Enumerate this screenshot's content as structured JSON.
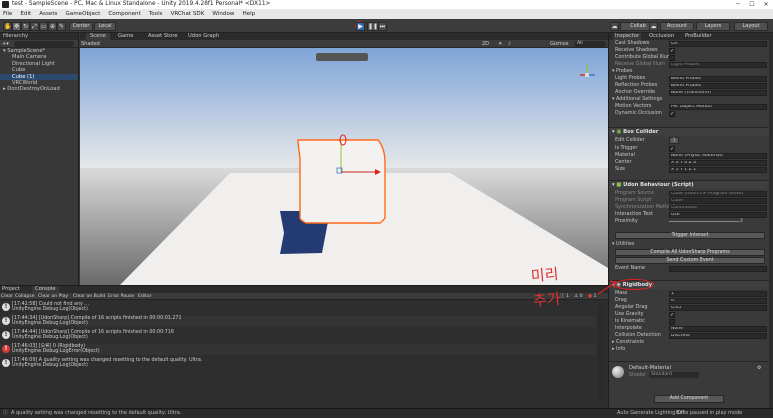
{
  "window": {
    "title": "test - SampleScene - PC, Mac & Linux Standalone - Unity 2019.4.28f1 Personal* <DX11>"
  },
  "menu": [
    "File",
    "Edit",
    "Assets",
    "GameObject",
    "Component",
    "Tools",
    "VRChat SDK",
    "Window",
    "Help"
  ],
  "toolbar": {
    "center": "Center",
    "local": "Local",
    "collab": "Collab",
    "account": "Account",
    "layers": "Layers",
    "layout": "Layout"
  },
  "hierarchy": {
    "tab": "Hierarchy",
    "root": "SampleScene*",
    "items": [
      "Main Camera",
      "Directional Light",
      "Cube",
      "Cube (1)",
      "VRCWorld"
    ],
    "dont_destroy": "DontDestroyOnLoad"
  },
  "scene": {
    "tabs": [
      "Scene",
      "Game",
      "Asset Store",
      "Udon Graph"
    ],
    "shading": "Shaded",
    "twod": "2D",
    "gizmos": "Gizmos",
    "search_all": "All"
  },
  "bottom": {
    "tabs": [
      "Project",
      "Console"
    ],
    "buttons": [
      "Clear",
      "Collapse",
      "Clear on Play",
      "Clear on Build",
      "Error Pause",
      "Editor"
    ],
    "logs": [
      {
        "l1": "[17:42:58] Could not find any ...",
        "l2": "UnityEngine.Debug:Log(Object)",
        "type": "info"
      },
      {
        "l1": "[17:44:34] [UdonSharp] Compile of 16 scripts finished in 00:00:01.271",
        "l2": "UnityEngine.Debug:Log(Object)",
        "type": "info"
      },
      {
        "l1": "[17:44:44] [UdonSharp] Compile of 16 scripts finished in 00:00:716",
        "l2": "UnityEngine.Debug:Log(Object)",
        "type": "info"
      },
      {
        "l1": "[17:46:03] [오류] 0 (Rigidbody)",
        "l2": "UnityEngine.Debug:LogError(Object)",
        "type": "error"
      },
      {
        "l1": "[17:46:09] A quality setting was changed resetting to the default quality: Ultra.",
        "l2": "UnityEngine.Debug:Log(Object)",
        "type": "info"
      }
    ],
    "counts": [
      "1",
      "0",
      "1"
    ]
  },
  "status": {
    "left": "A quality setting was changed resetting to the default quality: Ultra.",
    "right1": "Auto Generate Lighting Off",
    "right2": "Bake paused in play mode"
  },
  "inspector": {
    "tabs": [
      "Inspector",
      "Occlusion",
      "ProBuilder"
    ],
    "top_rows": [
      [
        "Cast Shadows",
        "On"
      ],
      [
        "Receive Shadows",
        ""
      ],
      [
        "Contribute Global Illum",
        ""
      ],
      [
        "Receive Global Illum",
        "Light Probes"
      ]
    ],
    "probes": {
      "title": "Probes",
      "rows": [
        [
          "Light Probes",
          "Blend Probes"
        ],
        [
          "Reflection Probes",
          "Blend Probes"
        ],
        [
          "Anchor Override",
          "None (Transform)"
        ]
      ]
    },
    "additional": {
      "title": "Additional Settings",
      "rows": [
        [
          "Motion Vectors",
          "Per Object Motion"
        ],
        [
          "Dynamic Occlusion",
          ""
        ]
      ]
    },
    "box_collider": {
      "title": "Box Collider",
      "rows": [
        [
          "Edit Collider",
          ""
        ],
        [
          "Is Trigger",
          ""
        ],
        [
          "Material",
          "None (Physic Material)"
        ],
        [
          "Center",
          "X 0  Y 0  Z 0"
        ],
        [
          "Size",
          "X 1  Y 1  Z 1"
        ]
      ]
    },
    "udon": {
      "title": "Udon Behaviour (Script)",
      "rows": [
        [
          "Program Source",
          "Cube (Udon C# Program Asset)"
        ],
        [
          "Program Script",
          "Cube"
        ],
        [
          "Synchronization Method",
          "Continuous"
        ],
        [
          "Interaction Text",
          "Use"
        ],
        [
          "Proximity",
          "2"
        ]
      ],
      "interact_btn": "Trigger Interact"
    },
    "utilities": {
      "title": "Utilities",
      "btn1": "Compile All UdonSharp Programs",
      "btn2": "Send Custom Event",
      "event_name": "Event Name"
    },
    "rigidbody": {
      "title": "Rigidbody",
      "rows": [
        [
          "Mass",
          "1"
        ],
        [
          "Drag",
          "0"
        ],
        [
          "Angular Drag",
          "0.05"
        ],
        [
          "Use Gravity",
          ""
        ],
        [
          "Is Kinematic",
          ""
        ],
        [
          "Interpolate",
          "None"
        ],
        [
          "Collision Detection",
          "Discrete"
        ]
      ],
      "constraints": "Constraints",
      "info": "Info"
    },
    "material": {
      "name": "Default-Material",
      "shader_label": "Shader",
      "shader": "Standard"
    },
    "add_component": "Add Component"
  },
  "annotation": {
    "line1": "미리",
    "line2": "추가"
  }
}
